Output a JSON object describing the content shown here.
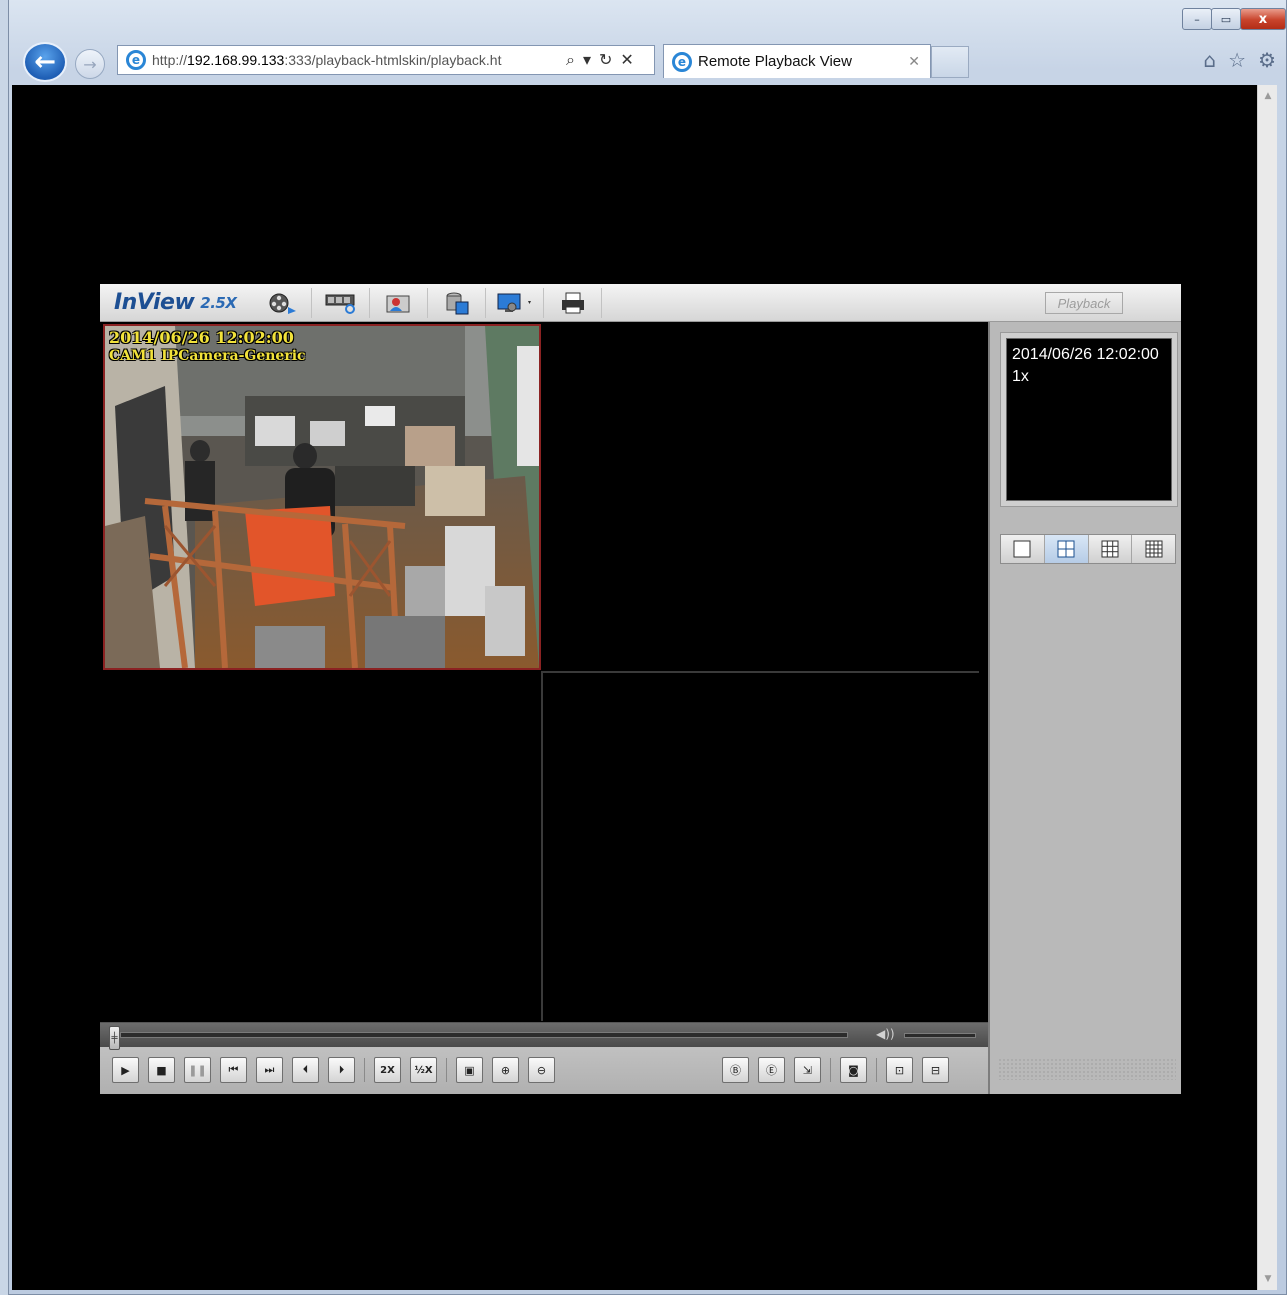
{
  "browser": {
    "url_prefix": "http://",
    "url_host": "192.168.99.133",
    "url_rest": ":333/playback-htmlskin/playback.ht",
    "tab_title": "Remote Playback View",
    "window_controls": {
      "minimize": "–",
      "maximize": "▭",
      "close": "x"
    }
  },
  "app": {
    "brand": "InView",
    "version": "2.5X",
    "mode_label": "Playback",
    "toolbar": [
      {
        "name": "playback-tool-icon"
      },
      {
        "name": "search-tool-icon"
      },
      {
        "name": "event-tool-icon"
      },
      {
        "name": "backup-tool-icon"
      },
      {
        "name": "settings-tool-icon"
      },
      {
        "name": "print-icon"
      }
    ]
  },
  "channels": [
    {
      "date": "2014/06/26 12:02:00",
      "camera": "CAM1 IPCamera-Generic"
    }
  ],
  "status": {
    "datetime": "2014/06/26 12:02:00",
    "speed": "1x"
  },
  "controls": {
    "speed_up": "2X",
    "speed_down": "½X",
    "seek_position": 0.0
  },
  "colors": {
    "selected_cell_border": "#8b2222",
    "osd_text": "#f2e23a",
    "brand": "#1d4f93"
  }
}
